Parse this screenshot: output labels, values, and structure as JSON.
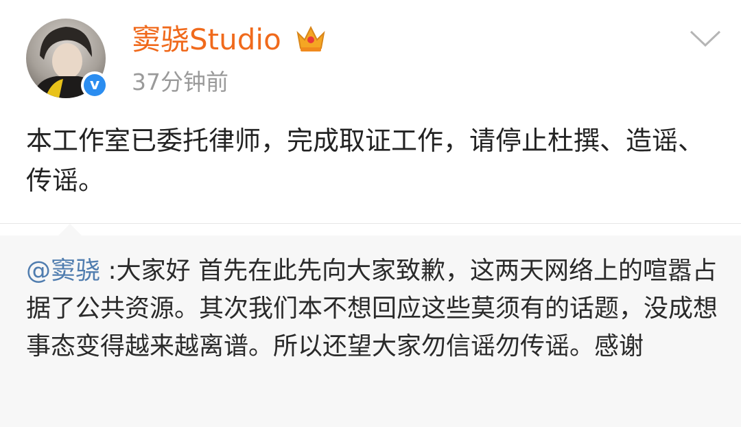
{
  "post": {
    "author": "窦骁Studio",
    "timestamp": "37分钟前",
    "text": "本工作室已委托律师，完成取证工作，请停止杜撰、造谣、传谣。"
  },
  "repost": {
    "mention": "@窦骁",
    "text": " :大家好 首先在此先向大家致歉，这两天网络上的喧嚣占据了公共资源。其次我们本不想回应这些莫须有的话题，没成想事态变得越来越离谱。所以还望大家勿信谣勿传谣。感谢"
  },
  "icons": {
    "verified": "verified-badge-icon",
    "crown": "vip-crown-icon",
    "menu": "chevron-down-icon"
  },
  "colors": {
    "author": "#f06a1c",
    "mention": "#507daf",
    "verified": "#2b8df0",
    "repost_bg": "#f7f7f7"
  }
}
